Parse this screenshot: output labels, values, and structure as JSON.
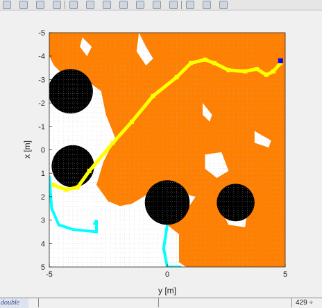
{
  "window": {
    "toolbar_icons": [
      "new-figure-icon",
      "open-file-icon",
      "pointer-icon",
      "edit-plot-icon",
      "zoom-in-icon",
      "zoom-out-icon",
      "pan-icon",
      "rotate-icon",
      "data-cursor-icon",
      "brush-icon",
      "link-icon",
      "colorbar-icon",
      "legend-icon",
      "grid-icon"
    ],
    "status_left": "double",
    "status_right": "429 ÷"
  },
  "colors": {
    "occupied": "#000000",
    "free": "#ffffff",
    "unknown": "#ff7f00",
    "path": "#ffff00",
    "inflation": "#00ffff",
    "goal": "#0000ff",
    "grid": "#bdbdbd",
    "background": "#f0f0f0"
  },
  "chart_data": {
    "type": "heatmap",
    "title": "",
    "xlabel": "y [m]",
    "ylabel": "x [m]",
    "xlim": [
      -5,
      5
    ],
    "ylim": [
      -5,
      5
    ],
    "y_reversed": true,
    "grid": true,
    "xticks": [
      "-5",
      "0",
      "5"
    ],
    "yticks": [
      "-5",
      "-4",
      "-3",
      "-2",
      "-1",
      "0",
      "1",
      "2",
      "3",
      "4",
      "5"
    ],
    "obstacles": [
      {
        "cy": -4.1,
        "cx": -2.5,
        "r": 0.95
      },
      {
        "cy": -4.0,
        "cx": 0.7,
        "r": 0.9
      },
      {
        "cy": 0.0,
        "cx": 2.25,
        "r": 0.95
      },
      {
        "cy": 2.9,
        "cx": 2.25,
        "r": 0.8
      }
    ],
    "free_regions": [
      [
        [
          -5.0,
          -4.0
        ],
        [
          -4.8,
          -3.6
        ],
        [
          -4.0,
          -2.8
        ],
        [
          -3.2,
          -2.8
        ],
        [
          -2.8,
          -2.5
        ],
        [
          -2.6,
          -1.5
        ],
        [
          -2.2,
          -0.5
        ],
        [
          -2.7,
          0.5
        ],
        [
          -3.0,
          1.5
        ],
        [
          -2.5,
          2.2
        ],
        [
          -2.0,
          2.4
        ],
        [
          -1.5,
          2.3
        ],
        [
          -1.0,
          2.0
        ],
        [
          -0.1,
          1.4
        ],
        [
          0.3,
          1.8
        ],
        [
          1.2,
          2.0
        ],
        [
          0.8,
          2.6
        ],
        [
          -0.2,
          2.8
        ],
        [
          0.0,
          3.2
        ],
        [
          0.5,
          3.6
        ],
        [
          0.5,
          4.8
        ],
        [
          0.8,
          5.0
        ],
        [
          -5.0,
          5.0
        ]
      ],
      [
        [
          1.6,
          0.2
        ],
        [
          2.3,
          0.1
        ],
        [
          2.6,
          0.9
        ],
        [
          2.1,
          1.2
        ],
        [
          1.6,
          0.8
        ]
      ],
      [
        [
          3.7,
          -0.8
        ],
        [
          4.4,
          -0.4
        ],
        [
          4.3,
          -0.1
        ],
        [
          3.7,
          -0.3
        ]
      ],
      [
        [
          2.2,
          2.4
        ],
        [
          3.4,
          2.5
        ],
        [
          3.3,
          3.3
        ],
        [
          2.6,
          3.2
        ]
      ],
      [
        [
          1.5,
          -2.0
        ],
        [
          1.9,
          -1.5
        ],
        [
          1.8,
          -1.2
        ],
        [
          1.5,
          -1.5
        ]
      ],
      [
        [
          -1.2,
          -5.0
        ],
        [
          -0.9,
          -4.4
        ],
        [
          -0.6,
          -3.9
        ],
        [
          -0.9,
          -3.6
        ],
        [
          -1.3,
          -4.2
        ]
      ],
      [
        [
          -3.6,
          -4.8
        ],
        [
          -3.2,
          -4.4
        ],
        [
          -3.4,
          -4.0
        ],
        [
          -3.7,
          -4.4
        ]
      ]
    ],
    "inflation_path": [
      [
        -5.0,
        1.1
      ],
      [
        -4.9,
        2.5
      ],
      [
        -4.6,
        3.2
      ],
      [
        -4.0,
        3.4
      ],
      [
        -3.0,
        3.5
      ],
      [
        -3.0,
        3.0
      ],
      [
        -3.1,
        3.2
      ]
    ],
    "inflation_path_2": [
      [
        0.0,
        3.2
      ],
      [
        -0.15,
        4.2
      ],
      [
        0.0,
        5.0
      ],
      [
        0.6,
        5.0
      ]
    ],
    "path": [
      [
        -4.8,
        1.5
      ],
      [
        -4.3,
        1.7
      ],
      [
        -3.8,
        1.6
      ],
      [
        -3.3,
        0.9
      ],
      [
        -2.3,
        -0.3
      ],
      [
        -1.5,
        -1.2
      ],
      [
        -0.6,
        -2.3
      ],
      [
        0.4,
        -3.1
      ],
      [
        1.0,
        -3.7
      ],
      [
        1.6,
        -3.85
      ],
      [
        2.0,
        -3.7
      ],
      [
        2.6,
        -3.4
      ],
      [
        3.3,
        -3.35
      ],
      [
        3.8,
        -3.45
      ],
      [
        4.2,
        -3.2
      ],
      [
        4.5,
        -3.35
      ],
      [
        4.8,
        -3.7
      ]
    ],
    "goal": {
      "y": 4.8,
      "x": -3.8
    }
  }
}
